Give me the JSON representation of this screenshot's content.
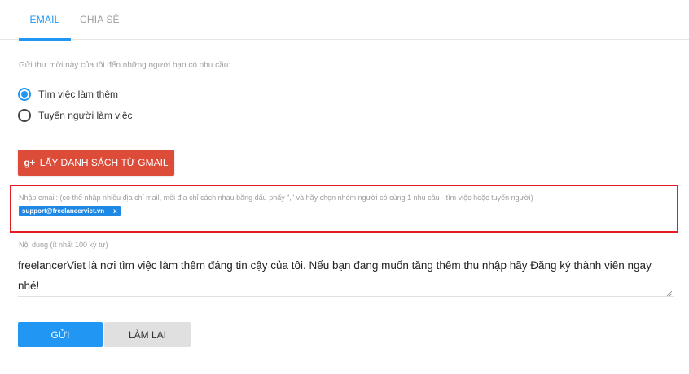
{
  "tabs": [
    {
      "label": "EMAIL",
      "active": true
    },
    {
      "label": "CHIA SẺ",
      "active": false
    }
  ],
  "intro": "Gửi thư mời này của tôi đến những người bạn có nhu cầu:",
  "radios": [
    {
      "label": "Tìm việc làm thêm",
      "checked": true
    },
    {
      "label": "Tuyển người làm việc",
      "checked": false
    }
  ],
  "gmail_button": {
    "icon": "g+-icon",
    "icon_text": "g+",
    "label": "LẤY DANH SÁCH TỪ GMAIL"
  },
  "email_field": {
    "label": "Nhập email: (có thể nhập nhiều địa chỉ mail, mỗi địa chỉ cách nhau bằng dấu phẩy \",\" và hãy chọn nhóm người có cùng 1 nhu cầu - tìm việc hoặc tuyển người)",
    "chips": [
      {
        "email": "support@freelancerviet.vn",
        "remove": "x"
      }
    ]
  },
  "content_field": {
    "label": "Nội dung (ít nhất 100 ký tự)",
    "value": "freelancerViet là nơi tìm việc làm thêm đáng tin cậy của tôi. Nếu bạn đang muốn tăng thêm thu nhập hãy Đăng ký thành viên ngay nhé!"
  },
  "buttons": {
    "send": "GỬI",
    "reset": "LÀM LẠI"
  },
  "colors": {
    "accent": "#2196f3",
    "gmail": "#dd4b39",
    "highlight_border": "#e31b23",
    "chip": "#1e88e5"
  }
}
